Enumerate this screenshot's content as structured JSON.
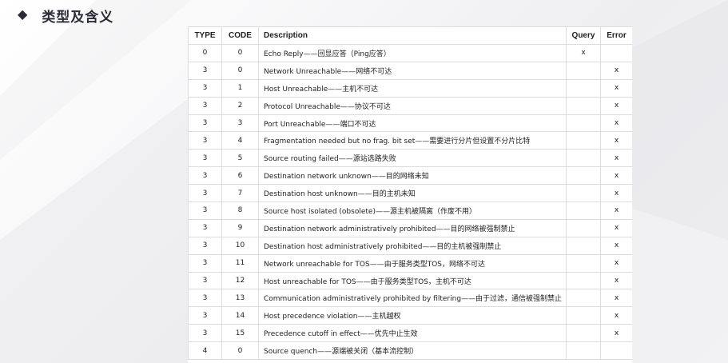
{
  "heading": {
    "bullet": "◆",
    "title": "类型及含义"
  },
  "table": {
    "headers": [
      "TYPE",
      "CODE",
      "Description",
      "Query",
      "Error"
    ],
    "rows": [
      {
        "type": "0",
        "code": "0",
        "description": "Echo Reply——回显应答（Ping应答）",
        "query": "x",
        "error": ""
      },
      {
        "type": "3",
        "code": "0",
        "description": "Network Unreachable——网络不可达",
        "query": "",
        "error": "x"
      },
      {
        "type": "3",
        "code": "1",
        "description": "Host Unreachable——主机不可达",
        "query": "",
        "error": "x"
      },
      {
        "type": "3",
        "code": "2",
        "description": "Protocol Unreachable——协议不可达",
        "query": "",
        "error": "x"
      },
      {
        "type": "3",
        "code": "3",
        "description": "Port Unreachable——端口不可达",
        "query": "",
        "error": "x"
      },
      {
        "type": "3",
        "code": "4",
        "description": "Fragmentation needed but no frag. bit set——需要进行分片但设置不分片比特",
        "query": "",
        "error": "x"
      },
      {
        "type": "3",
        "code": "5",
        "description": "Source routing failed——源站选路失败",
        "query": "",
        "error": "x"
      },
      {
        "type": "3",
        "code": "6",
        "description": "Destination network unknown——目的网络未知",
        "query": "",
        "error": "x"
      },
      {
        "type": "3",
        "code": "7",
        "description": "Destination host unknown——目的主机未知",
        "query": "",
        "error": "x"
      },
      {
        "type": "3",
        "code": "8",
        "description": "Source host isolated (obsolete)——源主机被隔离（作废不用）",
        "query": "",
        "error": "x"
      },
      {
        "type": "3",
        "code": "9",
        "description": "Destination network administratively prohibited——目的网络被强制禁止",
        "query": "",
        "error": "x"
      },
      {
        "type": "3",
        "code": "10",
        "description": "Destination host administratively prohibited——目的主机被强制禁止",
        "query": "",
        "error": "x"
      },
      {
        "type": "3",
        "code": "11",
        "description": "Network unreachable for TOS——由于服务类型TOS，网络不可达",
        "query": "",
        "error": "x"
      },
      {
        "type": "3",
        "code": "12",
        "description": "Host unreachable for TOS——由于服务类型TOS，主机不可达",
        "query": "",
        "error": "x"
      },
      {
        "type": "3",
        "code": "13",
        "description": "Communication administratively prohibited by filtering——由于过滤，通信被强制禁止",
        "query": "",
        "error": "x"
      },
      {
        "type": "3",
        "code": "14",
        "description": "Host precedence violation——主机越权",
        "query": "",
        "error": "x"
      },
      {
        "type": "3",
        "code": "15",
        "description": "Precedence cutoff in effect——优先中止生效",
        "query": "",
        "error": "x"
      },
      {
        "type": "4",
        "code": "0",
        "description": "Source quench——源端被关闭（基本流控制）",
        "query": "",
        "error": ""
      }
    ]
  }
}
